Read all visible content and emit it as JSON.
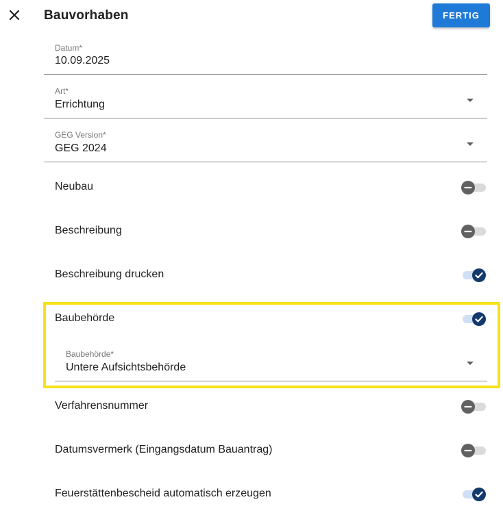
{
  "header": {
    "title": "Bauvorhaben",
    "done_label": "FERTIG"
  },
  "fields": {
    "datum": {
      "label": "Datum*",
      "value": "10.09.2025"
    },
    "art": {
      "label": "Art*",
      "value": "Errichtung"
    },
    "geg_version": {
      "label": "GEG Version*",
      "value": "GEG 2024"
    },
    "baubehoerde": {
      "label": "Baubehörde*",
      "value": "Untere Aufsichtsbehörde"
    }
  },
  "toggles": [
    {
      "label": "Neubau",
      "state": "off"
    },
    {
      "label": "Beschreibung",
      "state": "off"
    },
    {
      "label": "Beschreibung drucken",
      "state": "on"
    },
    {
      "label": "Baubehörde",
      "state": "on"
    },
    {
      "label": "Verfahrensnummer",
      "state": "off"
    },
    {
      "label": "Datumsvermerk (Eingangsdatum Bauantrag)",
      "state": "off"
    },
    {
      "label": "Feuerstättenbescheid automatisch erzeugen",
      "state": "on"
    }
  ],
  "colors": {
    "primary": "#1e7ad6",
    "toggle_on_knob": "#143a6b",
    "toggle_off_knob": "#616161",
    "highlight": "#f7e21a"
  }
}
